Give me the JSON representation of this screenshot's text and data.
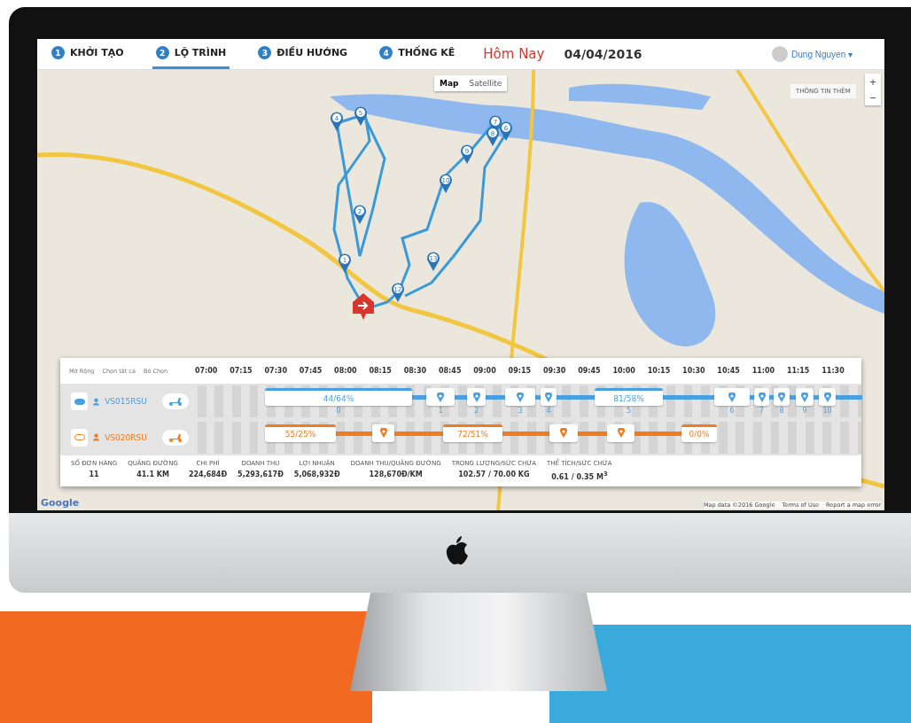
{
  "nav": {
    "steps": [
      {
        "number": "1",
        "label": "KHỞI TẠO",
        "selected": false
      },
      {
        "number": "2",
        "label": "LỘ TRÌNH",
        "selected": true
      },
      {
        "number": "3",
        "label": "ĐIỀU HƯỚNG",
        "selected": false
      },
      {
        "number": "4",
        "label": "THỐNG KÊ",
        "selected": false
      }
    ],
    "today": "Hôm Nay",
    "date": "04/04/2016",
    "user": "Dung Nguyen",
    "user_caret": "▾"
  },
  "map": {
    "type_buttons": [
      {
        "label": "Map",
        "selected": true
      },
      {
        "label": "Satellite",
        "selected": false
      }
    ],
    "info_button": "THÔNG TIN THÊM",
    "zoom_in": "+",
    "zoom_out": "−",
    "markers": [
      "4",
      "5",
      "7",
      "8",
      "6",
      "9",
      "10",
      "2",
      "1",
      "13",
      "12"
    ],
    "google": "Google",
    "attribution": [
      "Map data ©2016 Google",
      "Terms of Use",
      "Report a map error"
    ]
  },
  "timeline": {
    "actions": [
      "Mở Rộng",
      "Chọn tất cả",
      "Bỏ Chọn"
    ],
    "times": [
      "07:00",
      "07:15",
      "07:30",
      "07:45",
      "08:00",
      "08:15",
      "08:30",
      "08:45",
      "09:00",
      "09:15",
      "09:30",
      "09:45",
      "10:00",
      "10:15",
      "10:30",
      "10:45",
      "11:00",
      "11:15",
      "11:30"
    ],
    "vehicles": [
      {
        "name": "VS015RSU",
        "on": true,
        "color": "#4a9fe0",
        "stops": [
          {
            "kind": "load",
            "text": "44/64%",
            "index": "0"
          },
          {
            "kind": "pin",
            "index": "1"
          },
          {
            "kind": "pin",
            "index": "2"
          },
          {
            "kind": "pin",
            "index": "3"
          },
          {
            "kind": "pin",
            "index": "4"
          },
          {
            "kind": "load",
            "text": "81/58%",
            "index": "5"
          },
          {
            "kind": "pin",
            "index": "6"
          },
          {
            "kind": "pin",
            "index": "7"
          },
          {
            "kind": "pin",
            "index": "8"
          },
          {
            "kind": "pin",
            "index": "9"
          },
          {
            "kind": "pin",
            "index": "10"
          }
        ]
      },
      {
        "name": "VS020RSU",
        "on": false,
        "color": "#f07c1e",
        "stops": [
          {
            "kind": "load",
            "text": "55/25%"
          },
          {
            "kind": "pin"
          },
          {
            "kind": "load",
            "text": "72/51%"
          },
          {
            "kind": "pin"
          },
          {
            "kind": "pin"
          },
          {
            "kind": "load",
            "text": "0/0%"
          }
        ]
      }
    ],
    "stats": [
      {
        "label": "SỐ ĐƠN HÀNG",
        "value": "11"
      },
      {
        "label": "QUÃNG ĐƯỜNG",
        "value": "41.1 KM"
      },
      {
        "label": "CHI PHÍ",
        "value": "224,684Đ"
      },
      {
        "label": "DOANH THU",
        "value": "5,293,617Đ"
      },
      {
        "label": "LỢI NHUẬN",
        "value": "5,068,932Đ"
      },
      {
        "label": "DOANH THU/QUÃNG ĐƯỜNG",
        "value": "128,670Đ/KM"
      },
      {
        "label": "TRỌNG LƯỢNG/SỨC CHỨA",
        "value": "102.57 / 70.00 KG"
      },
      {
        "label": "THỂ TÍCH/SỨC CHỨA",
        "value": "0.61 / 0.35 M$^{3}$"
      }
    ]
  }
}
